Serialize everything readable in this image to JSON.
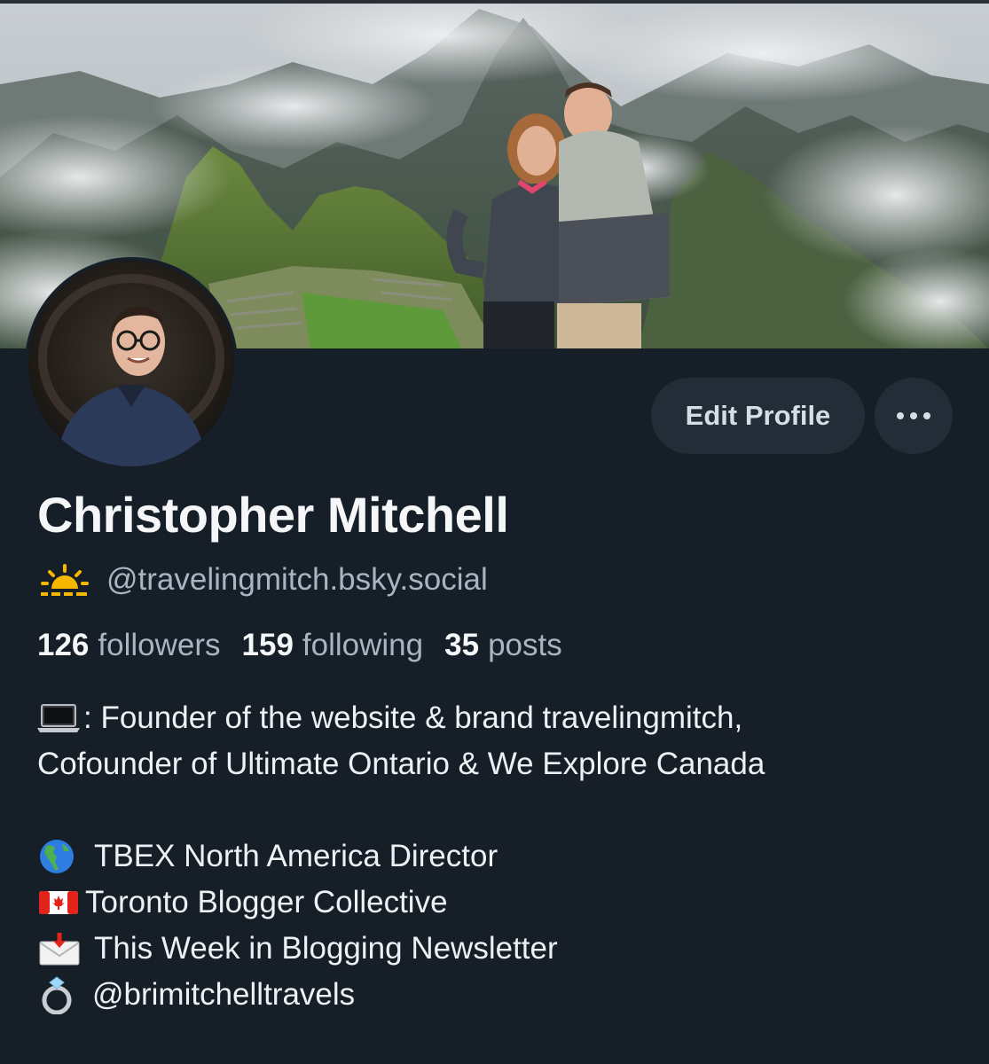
{
  "profile": {
    "display_name": "Christopher Mitchell",
    "handle": "@travelingmitch.bsky.social",
    "handle_icon": "sunrise-icon",
    "stats": {
      "followers_count": "126",
      "followers_label": "followers",
      "following_count": "159",
      "following_label": "following",
      "posts_count": "35",
      "posts_label": "posts"
    },
    "bio": {
      "line1": ": Founder of the website & brand travelingmitch,",
      "line2": "Cofounder of Ultimate Ontario & We Explore Canada",
      "line3": "TBEX North America Director",
      "line4": "Toronto Blogger Collective",
      "line5": "This Week in Blogging Newsletter",
      "line6": "@brimitchelltravels"
    },
    "bio_icons": [
      "laptop-icon",
      "globe-americas-icon",
      "canada-flag-icon",
      "envelope-arrow-icon",
      "ring-icon"
    ]
  },
  "actions": {
    "edit_label": "Edit Profile",
    "more_icon": "ellipsis-icon"
  },
  "colors": {
    "background": "#161e27",
    "button_bg": "#232d38",
    "secondary_text": "#a9b5c2"
  }
}
